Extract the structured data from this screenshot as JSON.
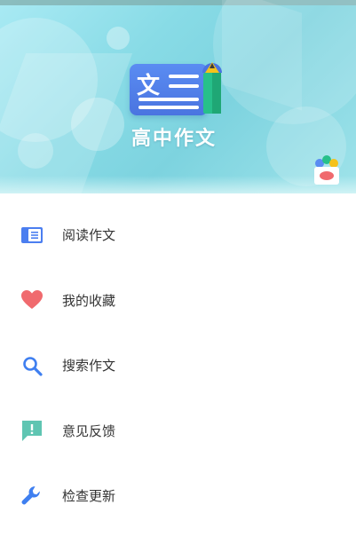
{
  "header": {
    "app_title": "高中作文",
    "logo_glyph": "文",
    "colors": {
      "banner_start": "#a9eaf4",
      "banner_end": "#7dd3df",
      "logo_blue": "#5a8cf2",
      "pencil_green": "#27c08a",
      "pencil_yellow": "#f5c21b"
    }
  },
  "menu": {
    "items": [
      {
        "label": "阅读作文",
        "icon": "book-icon",
        "color": "#4b7ef0"
      },
      {
        "label": "我的收藏",
        "icon": "heart-icon",
        "color": "#f06a6e"
      },
      {
        "label": "搜索作文",
        "icon": "search-icon",
        "color": "#3f7ff0"
      },
      {
        "label": "意见反馈",
        "icon": "feedback-icon",
        "color": "#5fc5b2"
      },
      {
        "label": "检查更新",
        "icon": "wrench-icon",
        "color": "#3f7ff0"
      }
    ]
  }
}
